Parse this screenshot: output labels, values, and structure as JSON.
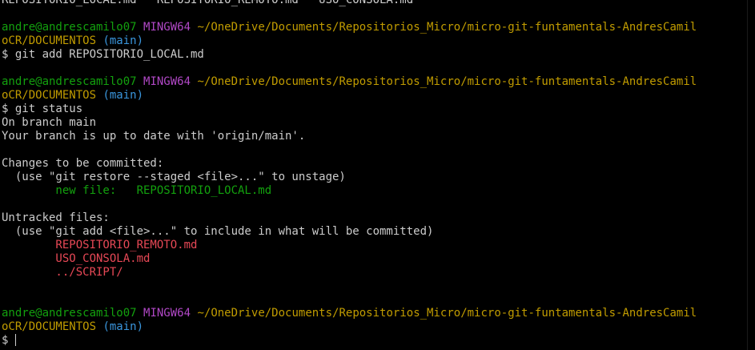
{
  "colors": {
    "background": "#000000",
    "text": "#cccccc",
    "user": "#13a10e",
    "env": "#b148c6",
    "path": "#c19c00",
    "branch": "#3a96dd",
    "staged": "#13a10e",
    "untracked": "#e74856"
  },
  "lines": [
    {
      "segments": [
        {
          "text": "REPOSITORIO_LOCAL.md   REPOSITORIO_REMOTO.md   USO_CONSOLA.md",
          "color": "#cccccc"
        }
      ]
    },
    {
      "segments": []
    },
    {
      "segments": [
        {
          "text": "andre@andrescamilo07",
          "color": "#13a10e"
        },
        {
          "text": " ",
          "color": "#cccccc"
        },
        {
          "text": "MINGW64",
          "color": "#b148c6"
        },
        {
          "text": " ",
          "color": "#cccccc"
        },
        {
          "text": "~/OneDrive/Documents/Repositorios_Micro/micro-git-funtamentals-AndresCamil",
          "color": "#c19c00"
        }
      ]
    },
    {
      "segments": [
        {
          "text": "oCR/DOCUMENTOS",
          "color": "#c19c00"
        },
        {
          "text": " ",
          "color": "#cccccc"
        },
        {
          "text": "(main)",
          "color": "#3a96dd"
        }
      ]
    },
    {
      "segments": [
        {
          "text": "$ git add REPOSITORIO_LOCAL.md",
          "color": "#cccccc"
        }
      ]
    },
    {
      "segments": []
    },
    {
      "segments": [
        {
          "text": "andre@andrescamilo07",
          "color": "#13a10e"
        },
        {
          "text": " ",
          "color": "#cccccc"
        },
        {
          "text": "MINGW64",
          "color": "#b148c6"
        },
        {
          "text": " ",
          "color": "#cccccc"
        },
        {
          "text": "~/OneDrive/Documents/Repositorios_Micro/micro-git-funtamentals-AndresCamil",
          "color": "#c19c00"
        }
      ]
    },
    {
      "segments": [
        {
          "text": "oCR/DOCUMENTOS",
          "color": "#c19c00"
        },
        {
          "text": " ",
          "color": "#cccccc"
        },
        {
          "text": "(main)",
          "color": "#3a96dd"
        }
      ]
    },
    {
      "segments": [
        {
          "text": "$ git status",
          "color": "#cccccc"
        }
      ]
    },
    {
      "segments": [
        {
          "text": "On branch main",
          "color": "#cccccc"
        }
      ]
    },
    {
      "segments": [
        {
          "text": "Your branch is up to date with 'origin/main'.",
          "color": "#cccccc"
        }
      ]
    },
    {
      "segments": []
    },
    {
      "segments": [
        {
          "text": "Changes to be committed:",
          "color": "#cccccc"
        }
      ]
    },
    {
      "segments": [
        {
          "text": "  (use \"git restore --staged <file>...\" to unstage)",
          "color": "#cccccc"
        }
      ]
    },
    {
      "segments": [
        {
          "text": "        new file:   REPOSITORIO_LOCAL.md",
          "color": "#13a10e"
        }
      ]
    },
    {
      "segments": []
    },
    {
      "segments": [
        {
          "text": "Untracked files:",
          "color": "#cccccc"
        }
      ]
    },
    {
      "segments": [
        {
          "text": "  (use \"git add <file>...\" to include in what will be committed)",
          "color": "#cccccc"
        }
      ]
    },
    {
      "segments": [
        {
          "text": "        REPOSITORIO_REMOTO.md",
          "color": "#e74856"
        }
      ]
    },
    {
      "segments": [
        {
          "text": "        USO_CONSOLA.md",
          "color": "#e74856"
        }
      ]
    },
    {
      "segments": [
        {
          "text": "        ../SCRIPT/",
          "color": "#e74856"
        }
      ]
    },
    {
      "segments": []
    },
    {
      "segments": []
    },
    {
      "segments": [
        {
          "text": "andre@andrescamilo07",
          "color": "#13a10e"
        },
        {
          "text": " ",
          "color": "#cccccc"
        },
        {
          "text": "MINGW64",
          "color": "#b148c6"
        },
        {
          "text": " ",
          "color": "#cccccc"
        },
        {
          "text": "~/OneDrive/Documents/Repositorios_Micro/micro-git-funtamentals-AndresCamil",
          "color": "#c19c00"
        }
      ]
    },
    {
      "segments": [
        {
          "text": "oCR/DOCUMENTOS",
          "color": "#c19c00"
        },
        {
          "text": " ",
          "color": "#cccccc"
        },
        {
          "text": "(main)",
          "color": "#3a96dd"
        }
      ]
    },
    {
      "segments": [
        {
          "text": "$ ",
          "color": "#cccccc"
        }
      ],
      "cursor": true
    }
  ]
}
